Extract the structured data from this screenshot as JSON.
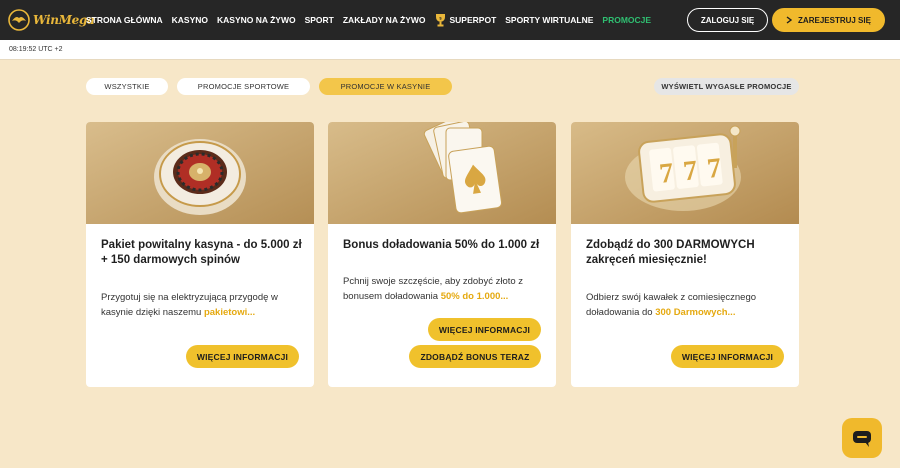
{
  "header": {
    "logo_text": "WinMega",
    "nav": [
      "STRONA GŁÓWNA",
      "KASYNO",
      "KASYNO NA ŻYWO",
      "SPORT",
      "ZAKŁADY NA ŻYWO",
      "SUPERPOT",
      "SPORTY WIRTUALNE",
      "PROMOCJE"
    ],
    "active_nav": "PROMOCJE",
    "login_label": "ZALOGUJ SIĘ",
    "register_label": "ZAREJESTRUJ SIĘ"
  },
  "timebar": {
    "time": "08:19:52 UTC +2"
  },
  "filters": {
    "items": [
      "WSZYSTKIE",
      "PROMOCJE SPORTOWE",
      "PROMOCJE W KASYNIE"
    ],
    "active": "PROMOCJE W KASYNIE",
    "expired_label": "WYŚWIETL WYGASŁE PROMOCJE"
  },
  "cards": [
    {
      "title": "Pakiet powitalny kasyna - do 5.000 zł + 150 darmowych spinów",
      "desc": "Przygotuj się na elektryzującą przygodę w kasynie dzięki naszemu ",
      "desc_highlight": "pakietowi...",
      "button": "WIĘCEJ INFORMACJI"
    },
    {
      "title": "Bonus doładowania 50% do 1.000 zł",
      "desc": "Pchnij swoje szczęście, aby zdobyć złoto z bonusem doładowania ",
      "desc_highlight": "50% do 1.000...",
      "button": "WIĘCEJ INFORMACJI",
      "button2": "ZDOBĄDŹ BONUS TERAZ"
    },
    {
      "title": "Zdobądź do 300 DARMOWYCH zakręceń miesięcznie!",
      "desc": "Odbierz swój kawałek z comiesięcznego doładowania do ",
      "desc_highlight": "300 Darmowych...",
      "button": "WIĘCEJ INFORMACJI"
    }
  ],
  "slot_digits": [
    "7",
    "7",
    "7"
  ],
  "icons": {
    "logo": "eagle-icon",
    "superpot": "trophy-icon",
    "register": "chevron-right-icon",
    "chat": "chat-bubble-icon"
  },
  "colors": {
    "topbar": "#262626",
    "accent": "#f0b92c",
    "active_nav": "#2fbf71",
    "page_bg": "#f7e7c8",
    "highlight_text": "#e5a90f"
  }
}
